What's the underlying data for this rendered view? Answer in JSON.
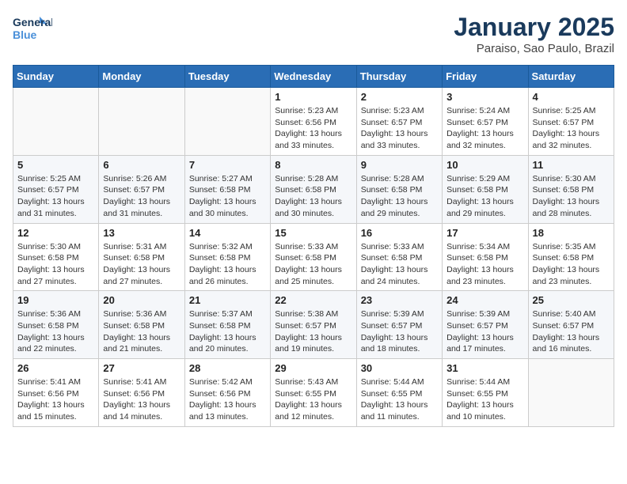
{
  "logo": {
    "line1": "General",
    "line2": "Blue"
  },
  "header": {
    "month": "January 2025",
    "location": "Paraiso, Sao Paulo, Brazil"
  },
  "weekdays": [
    "Sunday",
    "Monday",
    "Tuesday",
    "Wednesday",
    "Thursday",
    "Friday",
    "Saturday"
  ],
  "weeks": [
    [
      {
        "day": "",
        "sunrise": "",
        "sunset": "",
        "daylight": ""
      },
      {
        "day": "",
        "sunrise": "",
        "sunset": "",
        "daylight": ""
      },
      {
        "day": "",
        "sunrise": "",
        "sunset": "",
        "daylight": ""
      },
      {
        "day": "1",
        "sunrise": "5:23 AM",
        "sunset": "6:56 PM",
        "daylight": "13 hours and 33 minutes."
      },
      {
        "day": "2",
        "sunrise": "5:23 AM",
        "sunset": "6:57 PM",
        "daylight": "13 hours and 33 minutes."
      },
      {
        "day": "3",
        "sunrise": "5:24 AM",
        "sunset": "6:57 PM",
        "daylight": "13 hours and 32 minutes."
      },
      {
        "day": "4",
        "sunrise": "5:25 AM",
        "sunset": "6:57 PM",
        "daylight": "13 hours and 32 minutes."
      }
    ],
    [
      {
        "day": "5",
        "sunrise": "5:25 AM",
        "sunset": "6:57 PM",
        "daylight": "13 hours and 31 minutes."
      },
      {
        "day": "6",
        "sunrise": "5:26 AM",
        "sunset": "6:57 PM",
        "daylight": "13 hours and 31 minutes."
      },
      {
        "day": "7",
        "sunrise": "5:27 AM",
        "sunset": "6:58 PM",
        "daylight": "13 hours and 30 minutes."
      },
      {
        "day": "8",
        "sunrise": "5:28 AM",
        "sunset": "6:58 PM",
        "daylight": "13 hours and 30 minutes."
      },
      {
        "day": "9",
        "sunrise": "5:28 AM",
        "sunset": "6:58 PM",
        "daylight": "13 hours and 29 minutes."
      },
      {
        "day": "10",
        "sunrise": "5:29 AM",
        "sunset": "6:58 PM",
        "daylight": "13 hours and 29 minutes."
      },
      {
        "day": "11",
        "sunrise": "5:30 AM",
        "sunset": "6:58 PM",
        "daylight": "13 hours and 28 minutes."
      }
    ],
    [
      {
        "day": "12",
        "sunrise": "5:30 AM",
        "sunset": "6:58 PM",
        "daylight": "13 hours and 27 minutes."
      },
      {
        "day": "13",
        "sunrise": "5:31 AM",
        "sunset": "6:58 PM",
        "daylight": "13 hours and 27 minutes."
      },
      {
        "day": "14",
        "sunrise": "5:32 AM",
        "sunset": "6:58 PM",
        "daylight": "13 hours and 26 minutes."
      },
      {
        "day": "15",
        "sunrise": "5:33 AM",
        "sunset": "6:58 PM",
        "daylight": "13 hours and 25 minutes."
      },
      {
        "day": "16",
        "sunrise": "5:33 AM",
        "sunset": "6:58 PM",
        "daylight": "13 hours and 24 minutes."
      },
      {
        "day": "17",
        "sunrise": "5:34 AM",
        "sunset": "6:58 PM",
        "daylight": "13 hours and 23 minutes."
      },
      {
        "day": "18",
        "sunrise": "5:35 AM",
        "sunset": "6:58 PM",
        "daylight": "13 hours and 23 minutes."
      }
    ],
    [
      {
        "day": "19",
        "sunrise": "5:36 AM",
        "sunset": "6:58 PM",
        "daylight": "13 hours and 22 minutes."
      },
      {
        "day": "20",
        "sunrise": "5:36 AM",
        "sunset": "6:58 PM",
        "daylight": "13 hours and 21 minutes."
      },
      {
        "day": "21",
        "sunrise": "5:37 AM",
        "sunset": "6:58 PM",
        "daylight": "13 hours and 20 minutes."
      },
      {
        "day": "22",
        "sunrise": "5:38 AM",
        "sunset": "6:57 PM",
        "daylight": "13 hours and 19 minutes."
      },
      {
        "day": "23",
        "sunrise": "5:39 AM",
        "sunset": "6:57 PM",
        "daylight": "13 hours and 18 minutes."
      },
      {
        "day": "24",
        "sunrise": "5:39 AM",
        "sunset": "6:57 PM",
        "daylight": "13 hours and 17 minutes."
      },
      {
        "day": "25",
        "sunrise": "5:40 AM",
        "sunset": "6:57 PM",
        "daylight": "13 hours and 16 minutes."
      }
    ],
    [
      {
        "day": "26",
        "sunrise": "5:41 AM",
        "sunset": "6:56 PM",
        "daylight": "13 hours and 15 minutes."
      },
      {
        "day": "27",
        "sunrise": "5:41 AM",
        "sunset": "6:56 PM",
        "daylight": "13 hours and 14 minutes."
      },
      {
        "day": "28",
        "sunrise": "5:42 AM",
        "sunset": "6:56 PM",
        "daylight": "13 hours and 13 minutes."
      },
      {
        "day": "29",
        "sunrise": "5:43 AM",
        "sunset": "6:55 PM",
        "daylight": "13 hours and 12 minutes."
      },
      {
        "day": "30",
        "sunrise": "5:44 AM",
        "sunset": "6:55 PM",
        "daylight": "13 hours and 11 minutes."
      },
      {
        "day": "31",
        "sunrise": "5:44 AM",
        "sunset": "6:55 PM",
        "daylight": "13 hours and 10 minutes."
      },
      {
        "day": "",
        "sunrise": "",
        "sunset": "",
        "daylight": ""
      }
    ]
  ],
  "labels": {
    "sunrise_prefix": "Sunrise: ",
    "sunset_prefix": "Sunset: ",
    "daylight_prefix": "Daylight: "
  }
}
